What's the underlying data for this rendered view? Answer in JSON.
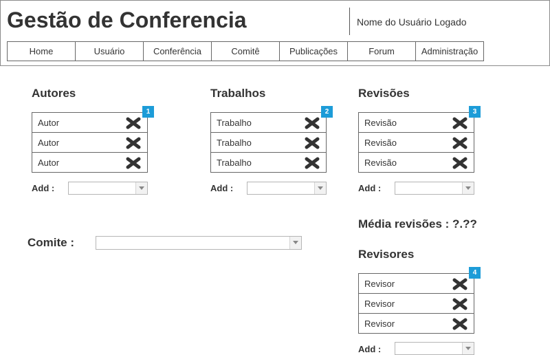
{
  "header": {
    "title": "Gestão de Conferencia",
    "user": "Nome do Usuário Logado"
  },
  "nav": [
    "Home",
    "Usuário",
    "Conferência",
    "Comitê",
    "Publicações",
    "Forum",
    "Administração"
  ],
  "autores": {
    "title": "Autores",
    "badge": "1",
    "items": [
      "Autor",
      "Autor",
      "Autor"
    ],
    "add_label": "Add :",
    "add_value": ""
  },
  "trabalhos": {
    "title": "Trabalhos",
    "badge": "2",
    "items": [
      "Trabalho",
      "Trabalho",
      "Trabalho"
    ],
    "add_label": "Add :",
    "add_value": ""
  },
  "revisoes": {
    "title": "Revisões",
    "badge": "3",
    "items": [
      "Revisão",
      "Revisão",
      "Revisão"
    ],
    "add_label": "Add :",
    "add_value": ""
  },
  "media": "Média revisões : ?.??",
  "revisores": {
    "title": "Revisores",
    "badge": "4",
    "items": [
      "Revisor",
      "Revisor",
      "Revisor"
    ],
    "add_label": "Add :",
    "add_value": ""
  },
  "comite": {
    "label": "Comite :",
    "value": ""
  },
  "icons": {
    "delete": "close-x-icon",
    "dropdown": "chevron-down-icon"
  },
  "colors": {
    "badge": "#1d9cd8",
    "text": "#333333",
    "delete_icon": "#333333"
  }
}
